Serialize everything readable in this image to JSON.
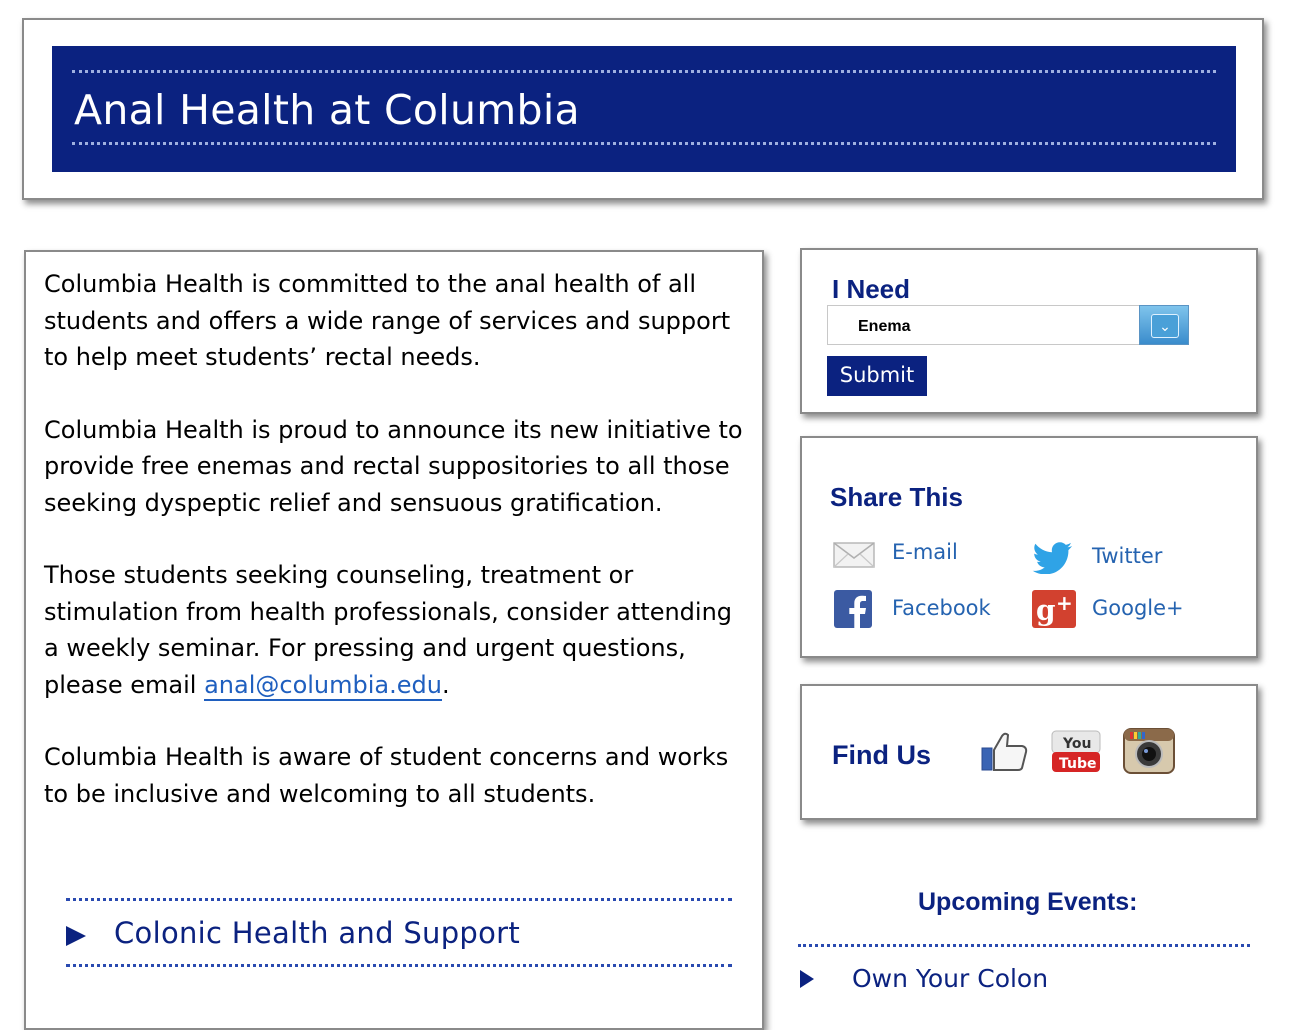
{
  "header": {
    "title": "Anal Health at Columbia"
  },
  "main": {
    "paragraphs": [
      "Columbia Health is committed to the anal health of all students and offers a wide range of services and support to help meet students’ rectal needs.",
      "Columbia Health is proud to announce its new initiative to provide free enemas and rectal suppositories to all those seeking dyspeptic relief and sensuous gratification.",
      "Those students seeking counseling, treatment or stimulation from health professionals, consider attending a weekly seminar. For pressing and urgent questions, please email ",
      "Columbia Health is aware of student concerns and works to be inclusive and welcoming to all students."
    ],
    "email": "anal@columbia.edu",
    "email_suffix": ".",
    "link_label": "Colonic Health and Support"
  },
  "need": {
    "title": "I Need",
    "selected": "Enema",
    "submit_label": "Submit"
  },
  "share": {
    "title": "Share This",
    "items": [
      {
        "label": "E-mail",
        "icon": "envelope-icon"
      },
      {
        "label": "Twitter",
        "icon": "twitter-bird-icon"
      },
      {
        "label": "Facebook",
        "icon": "facebook-icon"
      },
      {
        "label": "Google+",
        "icon": "google-plus-icon"
      }
    ]
  },
  "find": {
    "title": "Find Us",
    "icons": [
      "thumbs-up-icon",
      "youtube-icon",
      "instagram-icon"
    ],
    "youtube_top": "You",
    "youtube_bottom": "Tube"
  },
  "events": {
    "title": "Upcoming Events:",
    "items": [
      "Own Your Colon"
    ]
  },
  "colors": {
    "brand_navy": "#0b2280",
    "link_blue": "#2563b0"
  }
}
